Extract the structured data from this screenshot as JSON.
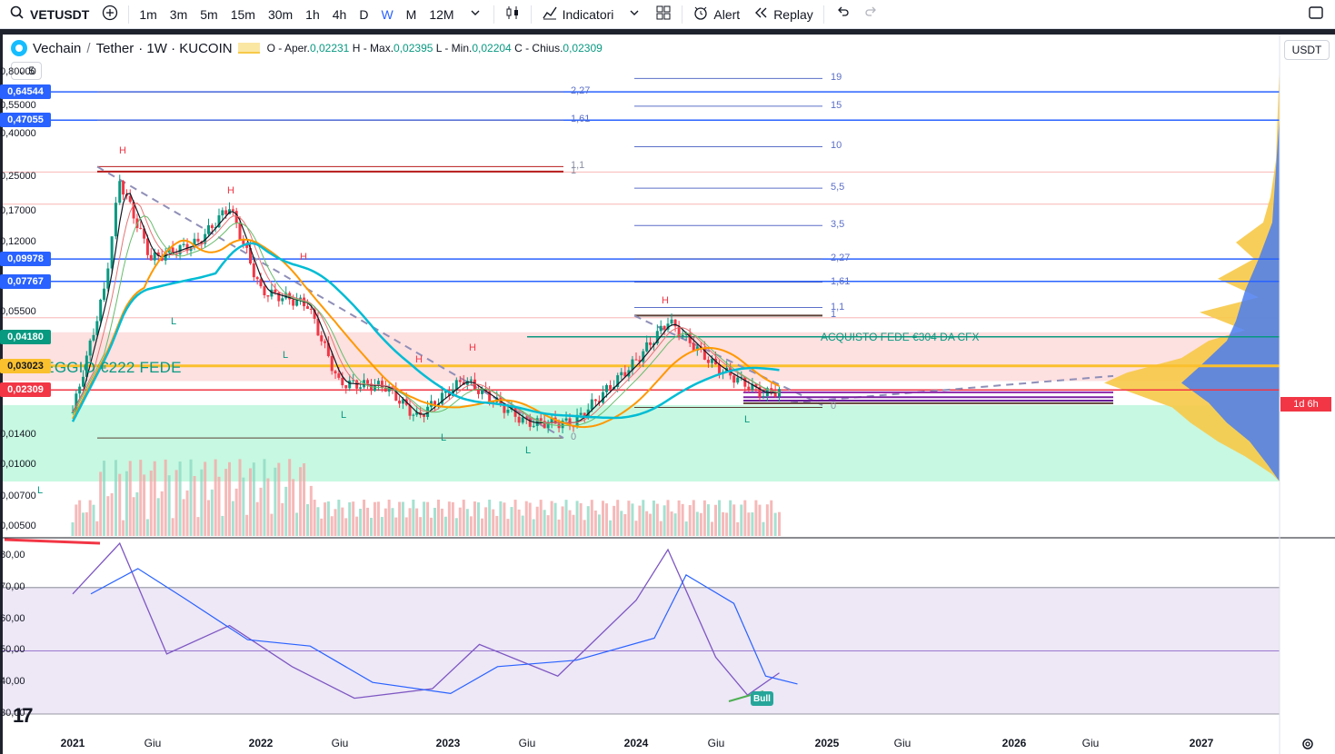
{
  "toolbar": {
    "symbol": "VETUSDT",
    "intervals": [
      "1m",
      "3m",
      "5m",
      "15m",
      "30m",
      "1h",
      "4h",
      "D",
      "W",
      "M",
      "12M"
    ],
    "active_interval": "W",
    "indicators_label": "Indicatori",
    "alert_label": "Alert",
    "replay_label": "Replay"
  },
  "legend": {
    "base": "Vechain",
    "separator": "/",
    "quote": "Tether",
    "meta": "· 1W · KUCOIN",
    "open_label": "O - Aper.",
    "open_value": "0,02231",
    "high_label": "H - Max.",
    "high_value": "0,02395",
    "low_label": "L - Min.",
    "low_value": "0,02204",
    "close_label": "C - Chius.",
    "close_value": "0,02309",
    "indicator_count": "5"
  },
  "currency": "USDT",
  "price_axis": {
    "ticks": [
      {
        "label": "0,80000",
        "value": 0.8
      },
      {
        "label": "0,55000",
        "value": 0.55
      },
      {
        "label": "0,40000",
        "value": 0.4
      },
      {
        "label": "0,25000",
        "value": 0.25
      },
      {
        "label": "0,17000",
        "value": 0.17
      },
      {
        "label": "0,12000",
        "value": 0.12
      },
      {
        "label": "0,05500",
        "value": 0.055
      },
      {
        "label": "0,01400",
        "value": 0.014
      },
      {
        "label": "0,01000",
        "value": 0.01
      },
      {
        "label": "0,00700",
        "value": 0.007
      },
      {
        "label": "0,00500",
        "value": 0.005
      }
    ],
    "tags": [
      {
        "label": "0,64544",
        "value": 0.64544,
        "color": "#2962ff"
      },
      {
        "label": "0,47055",
        "value": 0.47055,
        "color": "#2962ff"
      },
      {
        "label": "0,09978",
        "value": 0.09978,
        "color": "#2962ff"
      },
      {
        "label": "0,07767",
        "value": 0.07767,
        "color": "#2962ff"
      },
      {
        "label": "0,04180",
        "value": 0.0418,
        "color": "#089981"
      },
      {
        "label": "0,03023",
        "value": 0.03023,
        "color": "#fbc02d"
      },
      {
        "label": "0,02309",
        "value": 0.02309,
        "color": "#f23645"
      }
    ],
    "countdown": "1d 6h"
  },
  "oscillator_axis": {
    "ticks": [
      "80,00",
      "70,00",
      "60,00",
      "50,00",
      "40,00",
      "30,00"
    ]
  },
  "time_axis": {
    "ticks": [
      {
        "label": "2021",
        "bold": true
      },
      {
        "label": "Giu",
        "bold": false
      },
      {
        "label": "2022",
        "bold": true
      },
      {
        "label": "Giu",
        "bold": false
      },
      {
        "label": "2023",
        "bold": true
      },
      {
        "label": "Giu",
        "bold": false
      },
      {
        "label": "2024",
        "bold": true
      },
      {
        "label": "Giu",
        "bold": false
      },
      {
        "label": "2025",
        "bold": true
      },
      {
        "label": "Giu",
        "bold": false
      },
      {
        "label": "2026",
        "bold": true
      },
      {
        "label": "Giu",
        "bold": false
      },
      {
        "label": "2027",
        "bold": true
      }
    ]
  },
  "annotations": {
    "pareggio": "PAREGGIO €222 FEDE",
    "acquisto": "ACQUISTO FEDE €304 DA CFX",
    "bull": "Bull",
    "fib_left": [
      "2,27",
      "1,61",
      "1,1",
      "1",
      "0"
    ],
    "fib_right": [
      "19",
      "15",
      "10",
      "5,5",
      "3,5",
      "2,27",
      "1,61",
      "1,1",
      "1",
      "0"
    ],
    "swing_high": "H",
    "swing_low": "L"
  },
  "colors": {
    "up": "#089981",
    "down": "#f23645",
    "hline_blue": "#2962ff",
    "rsi_line": "#7e57c2",
    "rsi_ma": "#2962ff",
    "rsi_band": "#ede7f6",
    "ma_orange": "#ff9800",
    "ma_teal": "#00bcd4",
    "ma_navy": "#3f51b5",
    "zone_red": "#fcd5d5",
    "zone_green": "#b9f6d9",
    "vp_yellow": "#f7c948",
    "vp_blue": "#4a7cf0"
  },
  "chart_data": {
    "type": "candlestick",
    "symbol": "VETUSDT",
    "exchange": "KUCOIN",
    "interval": "1W",
    "ohlc_last": {
      "open": 0.02231,
      "high": 0.02395,
      "low": 0.02204,
      "close": 0.02309
    },
    "scale": "log",
    "y_range": [
      0.0045,
      0.9
    ],
    "horizontal_levels": [
      0.64544,
      0.47055,
      0.09978,
      0.07767,
      0.0418,
      0.03023,
      0.02309
    ],
    "closes_approx": [
      {
        "t": "2021-01",
        "c": 0.018
      },
      {
        "t": "2021-03",
        "c": 0.07
      },
      {
        "t": "2021-04",
        "c": 0.24
      },
      {
        "t": "2021-06",
        "c": 0.1
      },
      {
        "t": "2021-09",
        "c": 0.12
      },
      {
        "t": "2021-11",
        "c": 0.18
      },
      {
        "t": "2022-01",
        "c": 0.07
      },
      {
        "t": "2022-04",
        "c": 0.06
      },
      {
        "t": "2022-06",
        "c": 0.025
      },
      {
        "t": "2022-09",
        "c": 0.024
      },
      {
        "t": "2022-11",
        "c": 0.017
      },
      {
        "t": "2023-02",
        "c": 0.026
      },
      {
        "t": "2023-06",
        "c": 0.016
      },
      {
        "t": "2023-09",
        "c": 0.016
      },
      {
        "t": "2024-01",
        "c": 0.032
      },
      {
        "t": "2024-03",
        "c": 0.05
      },
      {
        "t": "2024-06",
        "c": 0.03
      },
      {
        "t": "2024-09",
        "c": 0.022
      },
      {
        "t": "2024-10",
        "c": 0.02309
      }
    ],
    "rsi_approx": [
      {
        "t": "2021-01",
        "v": 68
      },
      {
        "t": "2021-04",
        "v": 84
      },
      {
        "t": "2021-07",
        "v": 49
      },
      {
        "t": "2021-11",
        "v": 58
      },
      {
        "t": "2022-03",
        "v": 45
      },
      {
        "t": "2022-07",
        "v": 35
      },
      {
        "t": "2022-12",
        "v": 38
      },
      {
        "t": "2023-03",
        "v": 52
      },
      {
        "t": "2023-08",
        "v": 42
      },
      {
        "t": "2024-01",
        "v": 66
      },
      {
        "t": "2024-03",
        "v": 82
      },
      {
        "t": "2024-06",
        "v": 48
      },
      {
        "t": "2024-08",
        "v": 36
      },
      {
        "t": "2024-10",
        "v": 43
      }
    ]
  }
}
